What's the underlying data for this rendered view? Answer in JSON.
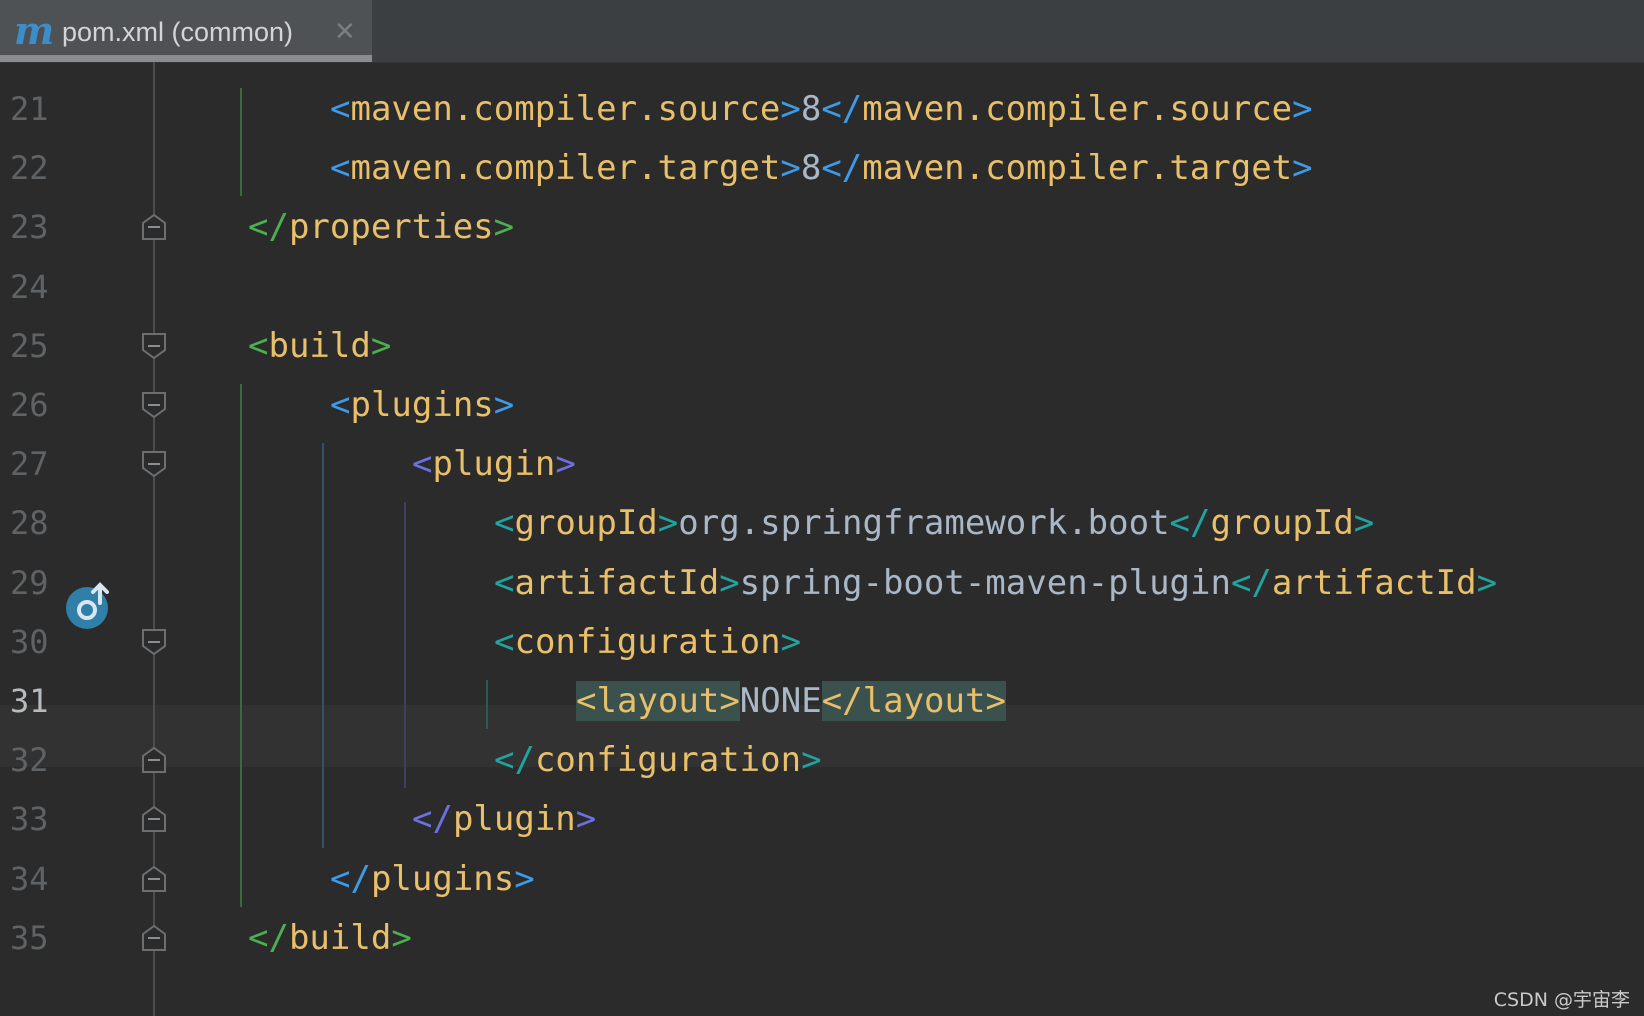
{
  "tab": {
    "icon": "maven-m-icon",
    "icon_glyph": "m",
    "label": "pom.xml (common)",
    "close_glyph": "✕"
  },
  "colors": {
    "background": "#2b2b2b",
    "tag_name": "#e8bf6a",
    "text": "#a9b7c6",
    "bracket_green": "#4caf50",
    "bracket_blue": "#3d9be9",
    "bracket_indigo": "#6d70e0",
    "bracket_teal": "#20a4a0",
    "match_highlight": "#3b514d"
  },
  "lines": [
    {
      "num": "21",
      "indent": 2,
      "bracket": "blue",
      "parts": [
        {
          "k": "b",
          "v": "<"
        },
        {
          "k": "t",
          "v": "maven.compiler.source"
        },
        {
          "k": "b",
          "v": ">"
        },
        {
          "k": "txt",
          "v": "8"
        },
        {
          "k": "b",
          "v": "</"
        },
        {
          "k": "t",
          "v": "maven.compiler.source"
        },
        {
          "k": "b",
          "v": ">"
        }
      ]
    },
    {
      "num": "22",
      "indent": 2,
      "bracket": "blue",
      "parts": [
        {
          "k": "b",
          "v": "<"
        },
        {
          "k": "t",
          "v": "maven.compiler.target"
        },
        {
          "k": "b",
          "v": ">"
        },
        {
          "k": "txt",
          "v": "8"
        },
        {
          "k": "b",
          "v": "</"
        },
        {
          "k": "t",
          "v": "maven.compiler.target"
        },
        {
          "k": "b",
          "v": ">"
        }
      ]
    },
    {
      "num": "23",
      "indent": 1,
      "bracket": "green",
      "fold": "end",
      "parts": [
        {
          "k": "b",
          "v": "</"
        },
        {
          "k": "t",
          "v": "properties"
        },
        {
          "k": "b",
          "v": ">"
        }
      ]
    },
    {
      "num": "24",
      "indent": 1,
      "bracket": "green",
      "parts": []
    },
    {
      "num": "25",
      "indent": 1,
      "bracket": "green",
      "fold": "start",
      "parts": [
        {
          "k": "b",
          "v": "<"
        },
        {
          "k": "t",
          "v": "build"
        },
        {
          "k": "b",
          "v": ">"
        }
      ]
    },
    {
      "num": "26",
      "indent": 2,
      "bracket": "blue",
      "fold": "start",
      "parts": [
        {
          "k": "b",
          "v": "<"
        },
        {
          "k": "t",
          "v": "plugins"
        },
        {
          "k": "b",
          "v": ">"
        }
      ]
    },
    {
      "num": "27",
      "indent": 3,
      "bracket": "indigo",
      "fold": "start",
      "parts": [
        {
          "k": "b",
          "v": "<"
        },
        {
          "k": "t",
          "v": "plugin"
        },
        {
          "k": "b",
          "v": ">"
        }
      ]
    },
    {
      "num": "28",
      "indent": 4,
      "bracket": "teal",
      "parts": [
        {
          "k": "b",
          "v": "<"
        },
        {
          "k": "t",
          "v": "groupId"
        },
        {
          "k": "b",
          "v": ">"
        },
        {
          "k": "txt",
          "v": "org.springframework.boot"
        },
        {
          "k": "b",
          "v": "</"
        },
        {
          "k": "t",
          "v": "groupId"
        },
        {
          "k": "b",
          "v": ">"
        }
      ]
    },
    {
      "num": "29",
      "indent": 4,
      "bracket": "teal",
      "parts": [
        {
          "k": "b",
          "v": "<"
        },
        {
          "k": "t",
          "v": "artifactId"
        },
        {
          "k": "b",
          "v": ">"
        },
        {
          "k": "txt",
          "v": "spring-boot-maven-plugin"
        },
        {
          "k": "b",
          "v": "</"
        },
        {
          "k": "t",
          "v": "artifactId"
        },
        {
          "k": "b",
          "v": ">"
        }
      ]
    },
    {
      "num": "30",
      "indent": 4,
      "bracket": "teal",
      "fold": "start",
      "parts": [
        {
          "k": "b",
          "v": "<"
        },
        {
          "k": "t",
          "v": "configuration"
        },
        {
          "k": "b",
          "v": ">"
        }
      ]
    },
    {
      "num": "31",
      "indent": 5,
      "bracket": "yellow",
      "active": true,
      "parts": [
        {
          "k": "b",
          "v": "<",
          "hl": true
        },
        {
          "k": "t",
          "v": "layout",
          "hl": true
        },
        {
          "k": "b",
          "v": ">",
          "hl": true
        },
        {
          "k": "txt",
          "v": "NONE"
        },
        {
          "k": "b",
          "v": "</",
          "hl": true
        },
        {
          "k": "t",
          "v": "layout",
          "hl": true
        },
        {
          "k": "b",
          "v": ">",
          "hl": true
        }
      ]
    },
    {
      "num": "32",
      "indent": 4,
      "bracket": "teal",
      "fold": "end",
      "parts": [
        {
          "k": "b",
          "v": "</"
        },
        {
          "k": "t",
          "v": "configuration"
        },
        {
          "k": "b",
          "v": ">"
        }
      ]
    },
    {
      "num": "33",
      "indent": 3,
      "bracket": "indigo",
      "fold": "end",
      "parts": [
        {
          "k": "b",
          "v": "</"
        },
        {
          "k": "t",
          "v": "plugin"
        },
        {
          "k": "b",
          "v": ">"
        }
      ]
    },
    {
      "num": "34",
      "indent": 2,
      "bracket": "blue",
      "fold": "end",
      "parts": [
        {
          "k": "b",
          "v": "</"
        },
        {
          "k": "t",
          "v": "plugins"
        },
        {
          "k": "b",
          "v": ">"
        }
      ]
    },
    {
      "num": "35",
      "indent": 1,
      "bracket": "green",
      "fold": "end",
      "parts": [
        {
          "k": "b",
          "v": "</"
        },
        {
          "k": "t",
          "v": "build"
        },
        {
          "k": "b",
          "v": ">"
        }
      ]
    }
  ],
  "gutter_badge": {
    "line": "29",
    "icon": "run-maven-goal-icon"
  },
  "watermark": "CSDN @宇宙李"
}
